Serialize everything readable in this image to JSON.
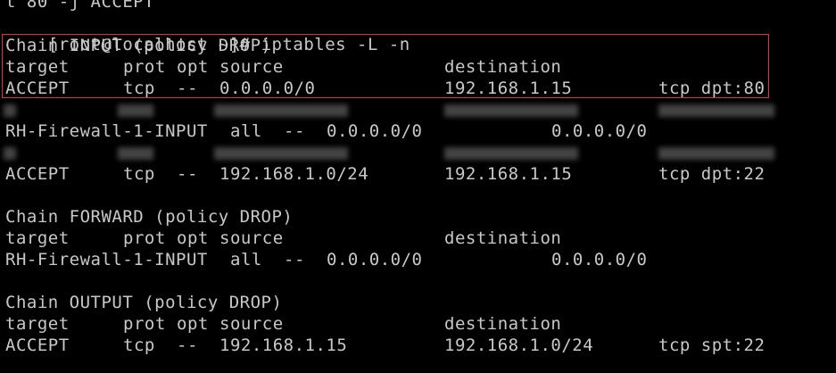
{
  "terminal": {
    "prev_line": "t 80 -j ACCEPT",
    "prompt": "[root@localhost ~]#",
    "command": "iptables -L -n",
    "highlight_color": "#d23a3a",
    "text_color": "#c8c8c8",
    "background_color": "#000000",
    "chains": [
      {
        "header": "Chain INPUT (policy DROP)",
        "columns": {
          "target": "target",
          "prot": "prot",
          "opt": "opt",
          "source": "source",
          "destination": "destination"
        },
        "rules": [
          {
            "target": "ACCEPT",
            "prot": "tcp",
            "opt": "--",
            "source": "0.0.0.0/0",
            "destination": "192.168.1.15",
            "extra": "tcp dpt:80"
          },
          {
            "target": "RH-Firewall-1-INPUT",
            "prot": "all",
            "opt": "--",
            "source": "0.0.0.0/0",
            "destination": "0.0.0.0/0",
            "extra": ""
          },
          {
            "target": "ACCEPT",
            "prot": "tcp",
            "opt": "--",
            "source": "192.168.1.0/24",
            "destination": "192.168.1.15",
            "extra": "tcp dpt:22"
          }
        ]
      },
      {
        "header": "Chain FORWARD (policy DROP)",
        "columns": {
          "target": "target",
          "prot": "prot",
          "opt": "opt",
          "source": "source",
          "destination": "destination"
        },
        "rules": [
          {
            "target": "RH-Firewall-1-INPUT",
            "prot": "all",
            "opt": "--",
            "source": "0.0.0.0/0",
            "destination": "0.0.0.0/0",
            "extra": ""
          }
        ]
      },
      {
        "header": "Chain OUTPUT (policy DROP)",
        "columns": {
          "target": "target",
          "prot": "prot",
          "opt": "opt",
          "source": "source",
          "destination": "destination"
        },
        "rules": [
          {
            "target": "ACCEPT",
            "prot": "tcp",
            "opt": "--",
            "source": "192.168.1.15",
            "destination": "192.168.1.0/24",
            "extra": "tcp spt:22"
          }
        ]
      }
    ]
  }
}
